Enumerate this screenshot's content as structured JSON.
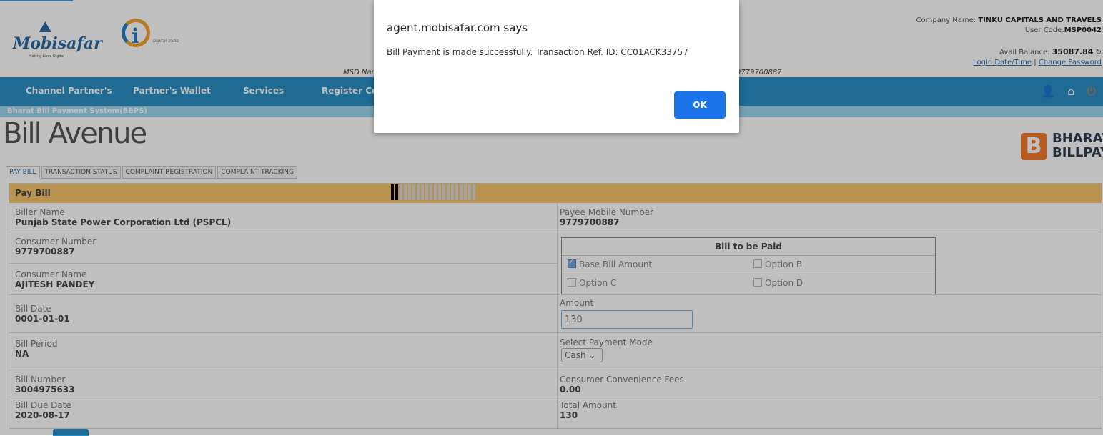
{
  "header": {
    "logo_text": "Mobisafar",
    "logo_tag": "Making Lives Digital",
    "digital_india": "Digital India",
    "msd_label": "MSD Name:",
    "mobile_partial": "9779700887",
    "company_label": "Company Name:",
    "company_name": "TINKU CAPITALS AND TRAVELS",
    "user_code_label": "User Code:",
    "user_code": "MSP0042",
    "balance_label": "Avail Balance:",
    "balance": "35087.84",
    "login_link": "Login Date/Time",
    "password_link": "Change Password"
  },
  "nav": {
    "items": [
      "Channel Partner's",
      "Partner's Wallet",
      "Services",
      "Register Con"
    ]
  },
  "subbar": "Bharat Bill Payment System(BBPS)",
  "brand": {
    "bill_avenue": "Bill Avenue",
    "bharat": "BHARAT",
    "billpay": "BILLPAY"
  },
  "tabs": [
    "PAY BILL",
    "TRANSACTION STATUS",
    "COMPLAINT REGISTRATION",
    "COMPLAINT TRACKING"
  ],
  "panel": {
    "title": "Pay Bill",
    "biller_name_label": "Biller Name",
    "biller_name": "Punjab State Power Corporation Ltd (PSPCL)",
    "payee_mobile_label": "Payee Mobile Number",
    "payee_mobile": "9779700887",
    "consumer_number_label": "Consumer Number",
    "consumer_number": "9779700887",
    "consumer_name_label": "Consumer Name",
    "consumer_name": "AJITESH PANDEY",
    "bill_to_be_paid": "Bill to be Paid",
    "option_base": "Base Bill Amount",
    "option_b": "Option B",
    "option_c": "Option C",
    "option_d": "Option D",
    "bill_date_label": "Bill Date",
    "bill_date": "0001-01-01",
    "amount_label": "Amount",
    "amount": "130",
    "bill_period_label": "Bill Period",
    "bill_period": "NA",
    "payment_mode_label": "Select Payment Mode",
    "payment_mode": "Cash",
    "bill_number_label": "Bill Number",
    "bill_number": "3004975633",
    "convenience_label": "Consumer Convenience Fees",
    "convenience": "0.00",
    "due_date_label": "Bill Due Date",
    "due_date": "2020-08-17",
    "total_label": "Total Amount",
    "total": "130"
  },
  "dialog": {
    "title": "agent.mobisafar.com says",
    "message": "Bill Payment is made successfully. Transaction Ref. ID: CC01ACK33757",
    "ok": "OK"
  }
}
